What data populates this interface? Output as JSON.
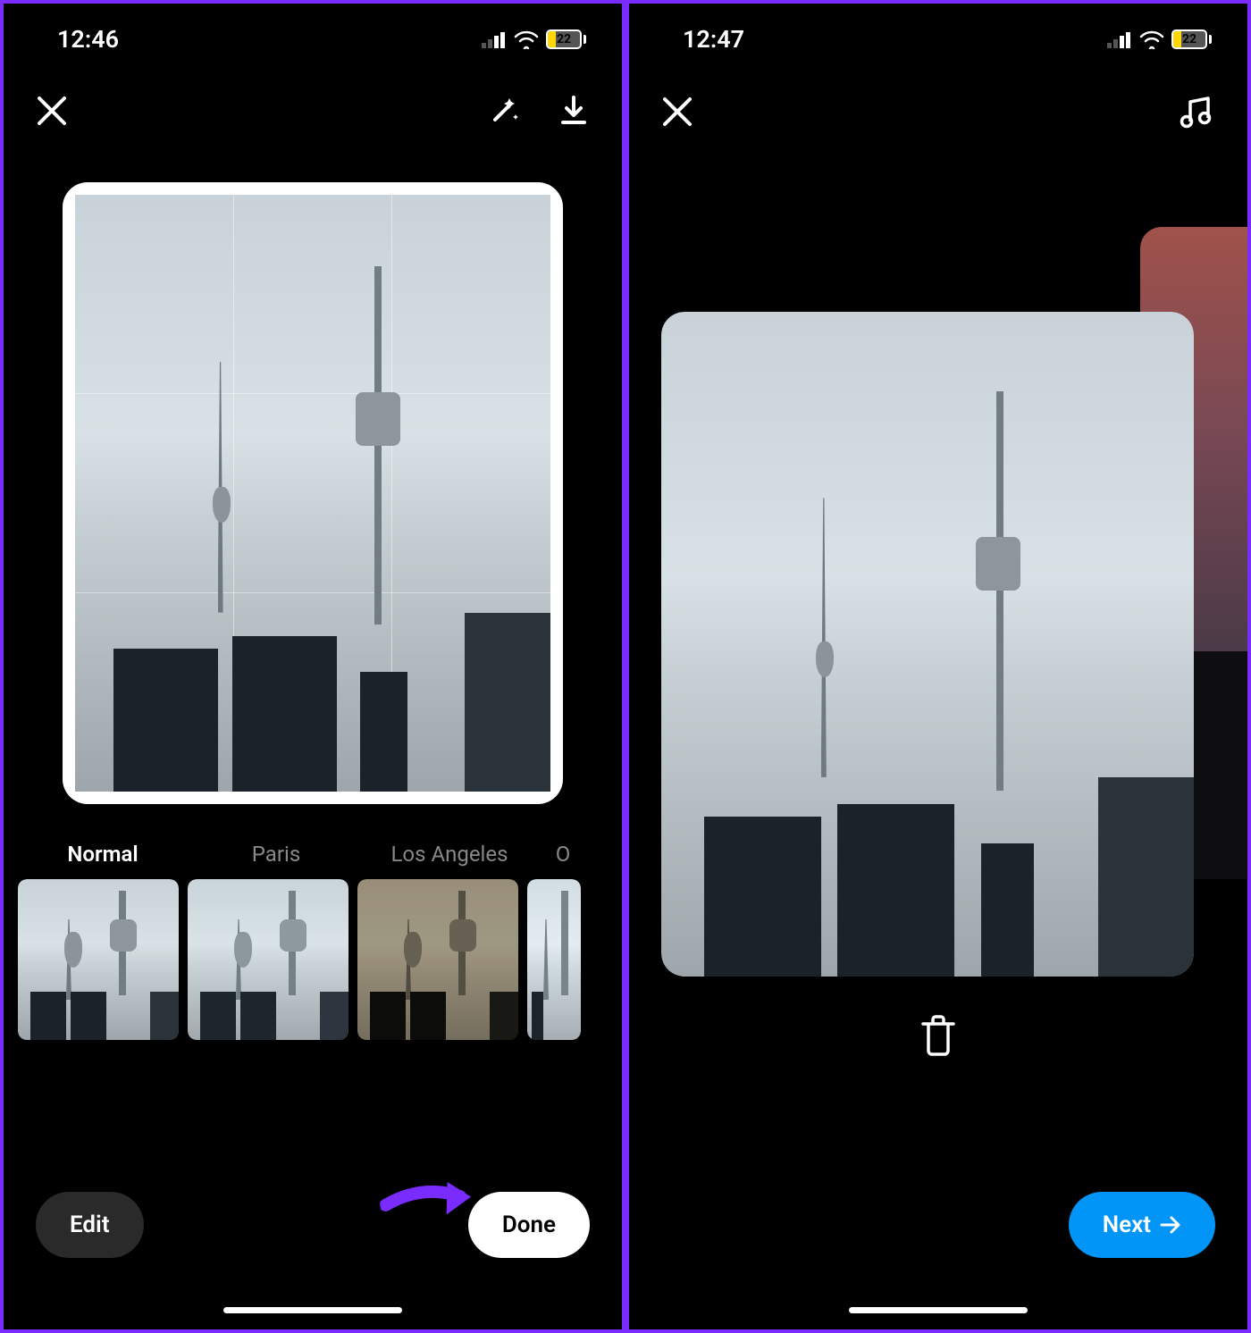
{
  "colors": {
    "accent": "#7a2cff",
    "primary_blue": "#0095f6",
    "battery": "#ffd60a"
  },
  "screen1": {
    "status": {
      "time": "12:46",
      "battery_pct": "22"
    },
    "filters": [
      {
        "label": "Normal",
        "active": true
      },
      {
        "label": "Paris",
        "active": false
      },
      {
        "label": "Los Angeles",
        "active": false
      },
      {
        "label": "O",
        "active": false
      }
    ],
    "buttons": {
      "edit": "Edit",
      "done": "Done"
    }
  },
  "screen2": {
    "status": {
      "time": "12:47",
      "battery_pct": "22"
    },
    "buttons": {
      "next": "Next"
    }
  }
}
